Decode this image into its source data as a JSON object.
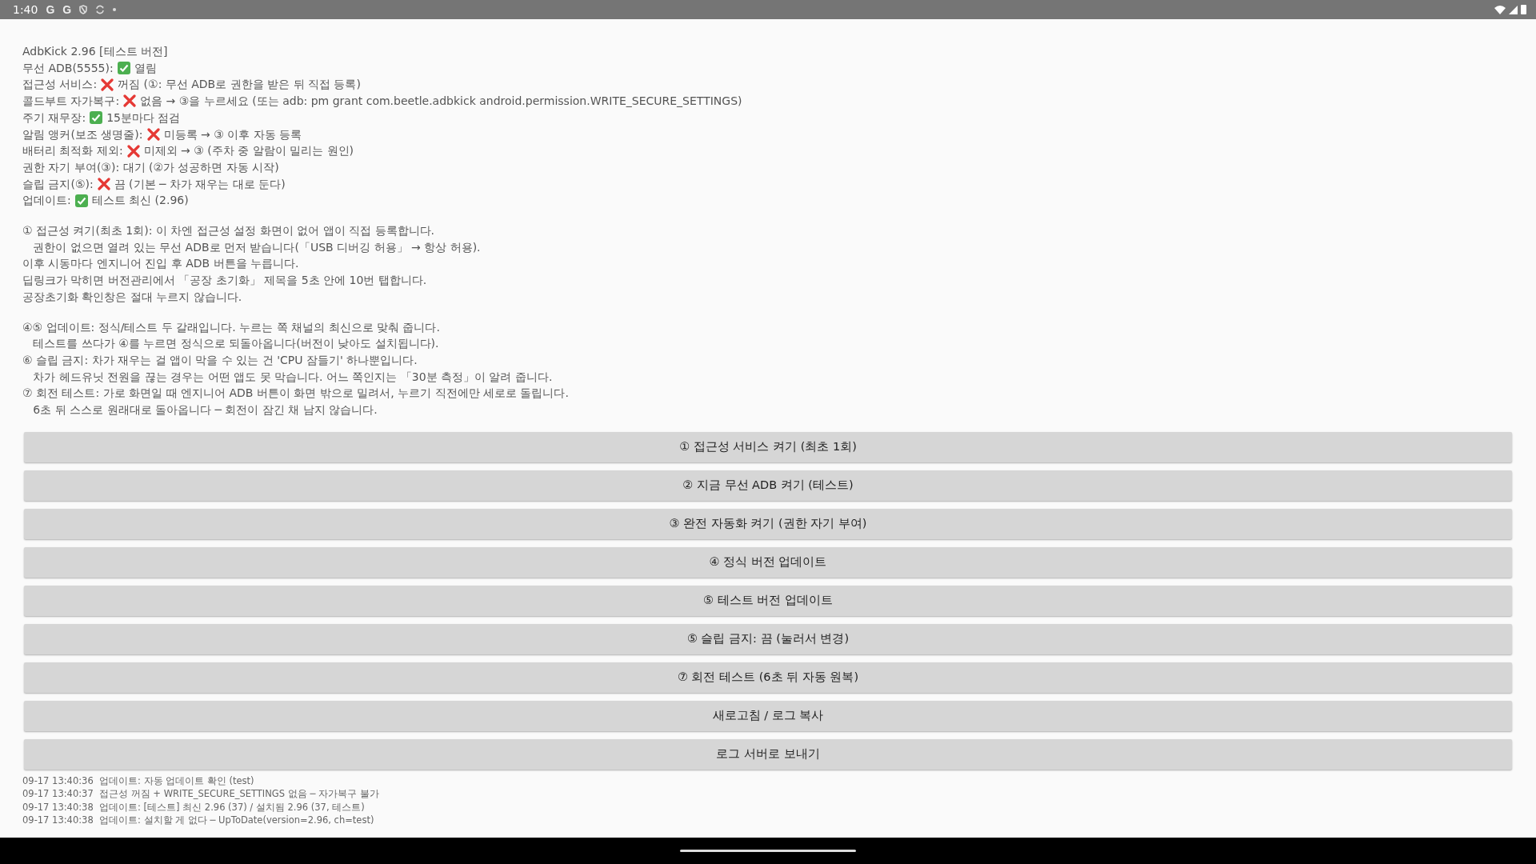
{
  "status_bar": {
    "time": "1:40",
    "notifications": [
      "G",
      "G"
    ]
  },
  "status_lines": [
    {
      "kind": "plain",
      "label": "AdbKick 2.96 [테스트 버전]"
    },
    {
      "kind": "ok",
      "label": "무선 ADB(5555):",
      "value": "열림"
    },
    {
      "kind": "fail",
      "label": "접근성 서비스:",
      "value": "꺼짐 (①: 무선 ADB로 권한을 받은 뒤 직접 등록)"
    },
    {
      "kind": "fail",
      "label": "콜드부트 자가복구:",
      "value": "없음 → ③을 누르세요 (또는 adb: pm grant com.beetle.adbkick android.permission.WRITE_SECURE_SETTINGS)"
    },
    {
      "kind": "ok",
      "label": "주기 재무장:",
      "value": "15분마다 점검"
    },
    {
      "kind": "fail",
      "label": "알림 앵커(보조 생명줄):",
      "value": "미등록 → ③ 이후 자동 등록"
    },
    {
      "kind": "fail",
      "label": "배터리 최적화 제외:",
      "value": "미제외 → ③ (주차 중 알람이 밀리는 원인)"
    },
    {
      "kind": "plain",
      "label": "권한 자기 부여(③): 대기 (②가 성공하면 자동 시작)"
    },
    {
      "kind": "fail",
      "label": "슬립 금지(⑤):",
      "value": "끔 (기본 ─ 차가 재우는 대로 둔다)"
    },
    {
      "kind": "ok",
      "label": "업데이트:",
      "value": "테스트 최신 (2.96)"
    }
  ],
  "notes": [
    [
      "① 접근성 켜기(최초 1회): 이 차엔 접근성 설정 화면이 없어 앱이 직접 등록합니다.",
      "   권한이 없으면 열려 있는 무선 ADB로 먼저 받습니다(「USB 디버깅 허용」 → 항상 허용).",
      "이후 시동마다 엔지니어 진입 후 ADB 버튼을 누릅니다.",
      "딥링크가 막히면 버전관리에서 「공장 초기화」 제목을 5초 안에 10번 탭합니다.",
      "공장초기화 확인창은 절대 누르지 않습니다."
    ],
    [
      "④⑤ 업데이트: 정식/테스트 두 갈래입니다. 누르는 쪽 채널의 최신으로 맞춰 줍니다.",
      "   테스트를 쓰다가 ④를 누르면 정식으로 되돌아옵니다(버전이 낮아도 설치됩니다).",
      "⑥ 슬립 금지: 차가 재우는 걸 앱이 막을 수 있는 건 'CPU 잠들기' 하나뿐입니다.",
      "   차가 헤드유닛 전원을 끊는 경우는 어떤 앱도 못 막습니다. 어느 쪽인지는 「30분 측정」이 알려 줍니다.",
      "⑦ 회전 테스트: 가로 화면일 때 엔지니어 ADB 버튼이 화면 밖으로 밀려서, 누르기 직전에만 세로로 돌립니다.",
      "   6초 뒤 스스로 원래대로 돌아옵니다 ─ 회전이 잠긴 채 남지 않습니다."
    ]
  ],
  "buttons": [
    "① 접근성 서비스 켜기 (최초 1회)",
    "② 지금 무선 ADB 켜기 (테스트)",
    "③ 완전 자동화 켜기 (권한 자기 부여)",
    "④ 정식 버전 업데이트",
    "⑤ 테스트 버전 업데이트",
    "⑤ 슬립 금지: 끔 (눌러서 변경)",
    "⑦ 회전 테스트 (6초 뒤 자동 원복)",
    "새로고침 / 로그 복사",
    "로그 서버로 보내기"
  ],
  "log": [
    "09-17 13:40:36  업데이트: 자동 업데이트 확인 (test)",
    "09-17 13:40:37  접근성 꺼짐 + WRITE_SECURE_SETTINGS 없음 ─ 자가복구 불가",
    "09-17 13:40:38  업데이트: [테스트] 최신 2.96 (37) / 설치됨 2.96 (37, 테스트)",
    "09-17 13:40:38  업데이트: 설치할 게 없다 ─ UpToDate(version=2.96, ch=test)"
  ]
}
